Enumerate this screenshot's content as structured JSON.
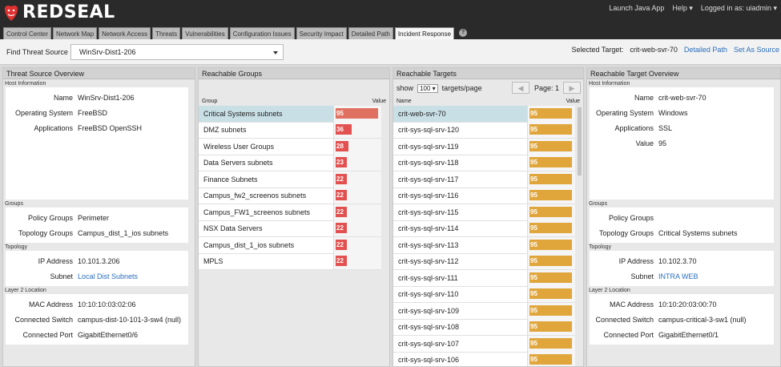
{
  "brand": {
    "name": "REDSEAL"
  },
  "header_links": {
    "launch": "Launch Java App",
    "help": "Help ▾",
    "login": "Logged in as: uiadmin ▾"
  },
  "nav_tabs": [
    {
      "label": "Control Center"
    },
    {
      "label": "Network Map"
    },
    {
      "label": "Network Access"
    },
    {
      "label": "Threats"
    },
    {
      "label": "Vulnerabilities"
    },
    {
      "label": "Configuration Issues"
    },
    {
      "label": "Security Impact"
    },
    {
      "label": "Detailed Path"
    },
    {
      "label": "Incident Response",
      "active": true
    }
  ],
  "help_icon": {
    "glyph": "?"
  },
  "toolbar": {
    "threat_source_label": "Find Threat Source",
    "threat_source_value": "WinSrv-Dist1-206",
    "selected_target_label": "Selected Target:",
    "selected_target_value": "crit-web-svr-70",
    "detailed_path_link": "Detailed Path",
    "set_as_source_link": "Set As Source"
  },
  "threat_source": {
    "title": "Threat Source Overview",
    "host_info_label": "Host Information",
    "host_info": [
      {
        "k": "Name",
        "v": "WinSrv-Dist1-206"
      },
      {
        "k": "Operating System",
        "v": "FreeBSD"
      },
      {
        "k": "Applications",
        "v": "FreeBSD OpenSSH"
      }
    ],
    "groups_label": "Groups",
    "groups": [
      {
        "k": "Policy Groups",
        "v": "Perimeter"
      },
      {
        "k": "Topology Groups",
        "v": "Campus_dist_1_ios subnets"
      }
    ],
    "topology_label": "Topology",
    "topology": [
      {
        "k": "IP Address",
        "v": "10.101.3.206"
      },
      {
        "k": "Subnet",
        "v": "Local Dist Subnets",
        "link": true
      }
    ],
    "l2_label": "Layer 2 Location",
    "l2": [
      {
        "k": "MAC Address",
        "v": "10:10:10:03:02:06"
      },
      {
        "k": "Connected Switch",
        "v": "campus-dist-10-101-3-sw4 (null)"
      },
      {
        "k": "Connected Port",
        "v": "GigabitEthernet0/6"
      }
    ]
  },
  "reachable_groups": {
    "title": "Reachable Groups",
    "col_group": "Group",
    "col_value": "Value",
    "color_high": "#e07060",
    "color_mid": "#e35050",
    "rows": [
      {
        "name": "Critical Systems subnets",
        "value": "95",
        "fill": 0.95
      },
      {
        "name": "DMZ subnets",
        "value": "36",
        "fill": 0.36
      },
      {
        "name": "Wireless User Groups",
        "value": "28",
        "fill": 0.28
      },
      {
        "name": "Data Servers subnets",
        "value": "23",
        "fill": 0.23
      },
      {
        "name": "Finance Subnets",
        "value": "22",
        "fill": 0.22
      },
      {
        "name": "Campus_fw2_screenos subnets",
        "value": "22",
        "fill": 0.22
      },
      {
        "name": "Campus_FW1_screenos subnets",
        "value": "22",
        "fill": 0.22
      },
      {
        "name": "NSX Data Servers",
        "value": "22",
        "fill": 0.22
      },
      {
        "name": "Campus_dist_1_ios subnets",
        "value": "22",
        "fill": 0.22
      },
      {
        "name": "MPLS",
        "value": "22",
        "fill": 0.22
      }
    ]
  },
  "reachable_targets": {
    "title": "Reachable Targets",
    "show_label": "show",
    "per_page": "100 ▾",
    "targets_per_page": "targets/page",
    "page_label": "Page: 1",
    "col_name": "Name",
    "col_value": "Value",
    "bar_color": "#e0a63c",
    "rows": [
      {
        "name": "crit-web-svr-70",
        "value": "95",
        "fill": 0.95
      },
      {
        "name": "crit-sys-sql-srv-120",
        "value": "95",
        "fill": 0.95
      },
      {
        "name": "crit-sys-sql-srv-119",
        "value": "95",
        "fill": 0.95
      },
      {
        "name": "crit-sys-sql-srv-118",
        "value": "95",
        "fill": 0.95
      },
      {
        "name": "crit-sys-sql-srv-117",
        "value": "95",
        "fill": 0.95
      },
      {
        "name": "crit-sys-sql-srv-116",
        "value": "95",
        "fill": 0.95
      },
      {
        "name": "crit-sys-sql-srv-115",
        "value": "95",
        "fill": 0.95
      },
      {
        "name": "crit-sys-sql-srv-114",
        "value": "95",
        "fill": 0.95
      },
      {
        "name": "crit-sys-sql-srv-113",
        "value": "95",
        "fill": 0.95
      },
      {
        "name": "crit-sys-sql-srv-112",
        "value": "95",
        "fill": 0.95
      },
      {
        "name": "crit-sys-sql-srv-111",
        "value": "95",
        "fill": 0.95
      },
      {
        "name": "crit-sys-sql-srv-110",
        "value": "95",
        "fill": 0.95
      },
      {
        "name": "crit-sys-sql-srv-109",
        "value": "95",
        "fill": 0.95
      },
      {
        "name": "crit-sys-sql-srv-108",
        "value": "95",
        "fill": 0.95
      },
      {
        "name": "crit-sys-sql-srv-107",
        "value": "95",
        "fill": 0.95
      },
      {
        "name": "crit-sys-sql-srv-106",
        "value": "95",
        "fill": 0.95
      }
    ]
  },
  "target_overview": {
    "title": "Reachable Target Overview",
    "host_info_label": "Host Information",
    "host_info": [
      {
        "k": "Name",
        "v": "crit-web-svr-70"
      },
      {
        "k": "Operating System",
        "v": "Windows"
      },
      {
        "k": "Applications",
        "v": "SSL"
      },
      {
        "k": "Value",
        "v": "95"
      }
    ],
    "groups_label": "Groups",
    "groups": [
      {
        "k": "Policy Groups",
        "v": ""
      },
      {
        "k": "Topology Groups",
        "v": "Critical Systems subnets"
      }
    ],
    "topology_label": "Topology",
    "topology": [
      {
        "k": "IP Address",
        "v": "10.102.3.70"
      },
      {
        "k": "Subnet",
        "v": "INTRA WEB",
        "link": true
      }
    ],
    "l2_label": "Layer 2 Location",
    "l2": [
      {
        "k": "MAC Address",
        "v": "10:10:20:03:00:70"
      },
      {
        "k": "Connected Switch",
        "v": "campus-critical-3-sw1 (null)"
      },
      {
        "k": "Connected Port",
        "v": "GigabitEthernet0/1"
      }
    ]
  }
}
